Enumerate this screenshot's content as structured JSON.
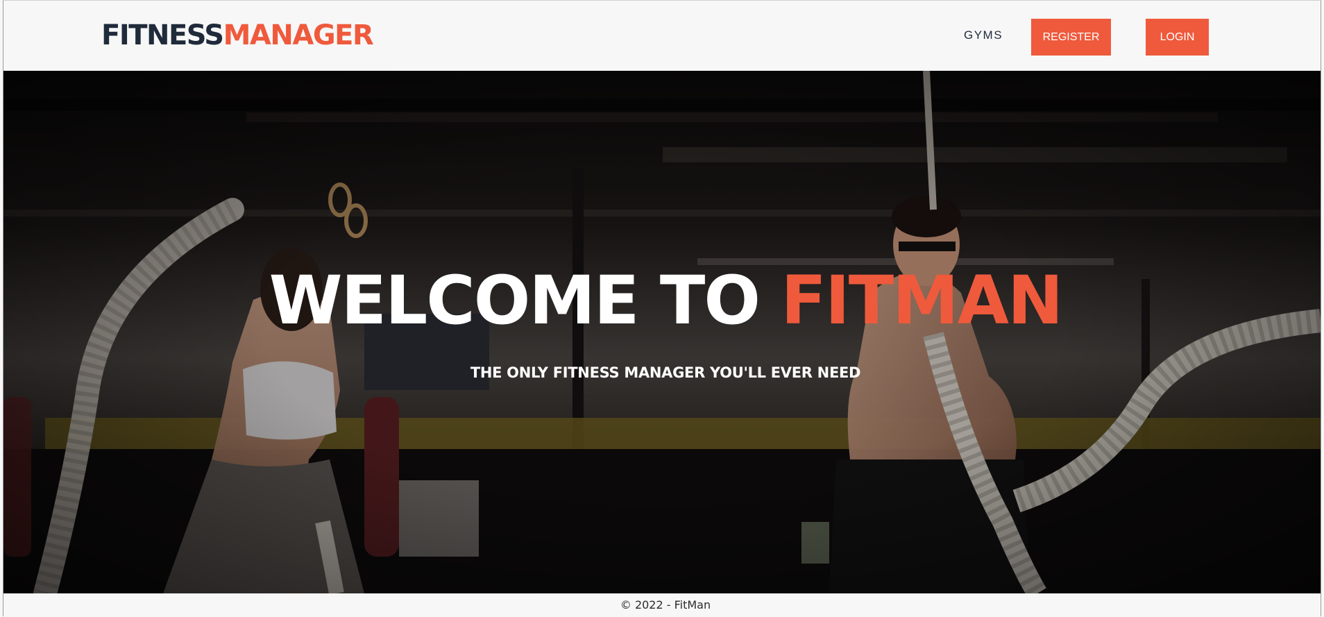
{
  "header": {
    "logo": {
      "part1": "FITNESS",
      "part2": "MANAGER"
    },
    "nav": {
      "gyms_label": "GYMS",
      "register_label": "REGISTER",
      "login_label": "LOGIN"
    }
  },
  "hero": {
    "title_part1": "WELCOME TO ",
    "title_part2": "FITMAN",
    "subtitle": "THE ONLY FITNESS MANAGER YOU'LL EVER NEED"
  },
  "footer": {
    "copyright": "© 2022 - FitMan"
  },
  "colors": {
    "accent": "#ef5a3c",
    "dark": "#1f2a3a",
    "background": "#f7f7f7"
  }
}
